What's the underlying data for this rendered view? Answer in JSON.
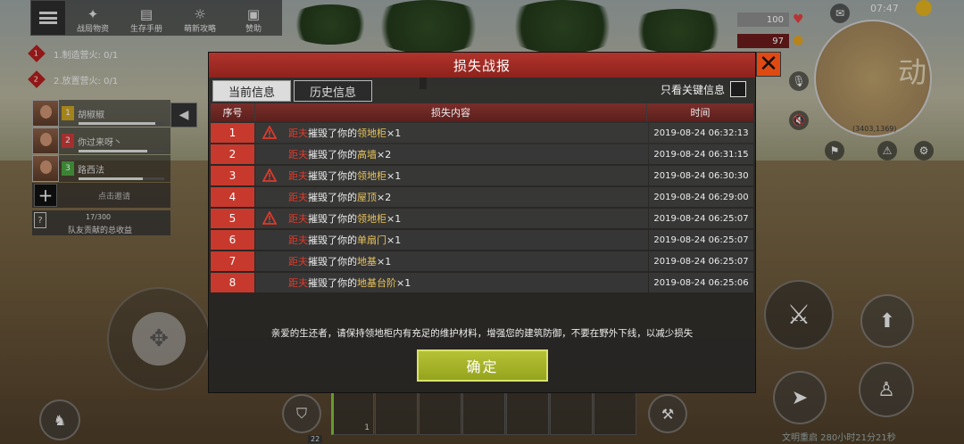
{
  "top_menu": {
    "items": [
      {
        "label": "战局物资",
        "icon": "treasure-icon"
      },
      {
        "label": "生存手册",
        "icon": "book-icon"
      },
      {
        "label": "萌新攻略",
        "icon": "guide-icon"
      },
      {
        "label": "赞助",
        "icon": "sponsor-icon"
      }
    ]
  },
  "quests": [
    {
      "text": "1.制造营火: 0/1",
      "num": "1"
    },
    {
      "text": "2.放置营火: 0/1",
      "num": "2"
    }
  ],
  "team": {
    "members": [
      {
        "num": "1",
        "name": "胡椒椒",
        "hp": 0.9,
        "color": "#c8a020"
      },
      {
        "num": "2",
        "name": "你过来呀丶",
        "hp": 0.8,
        "color": "#c83a3a"
      },
      {
        "num": "3",
        "name": "路西法",
        "hp": 0.75,
        "color": "#4aa040"
      }
    ],
    "invite_label": "点击邀请",
    "contribution_count": "17/300",
    "contribution_label": "队友贡献的总收益"
  },
  "status": {
    "health": "100",
    "food": "97",
    "clock": "07:47",
    "coords": "(3403,1369)",
    "map_label": "动",
    "civ_text": "文明重启 280小时21分21秒"
  },
  "hotbar": {
    "first_count": "1",
    "level": "22"
  },
  "dialog": {
    "title": "损失战报",
    "tabs": {
      "current": "当前信息",
      "history": "历史信息"
    },
    "filter_label": "只看关键信息",
    "columns": {
      "index": "序号",
      "content": "损失内容",
      "time": "时间"
    },
    "rows": [
      {
        "index": "1",
        "warn": true,
        "who": "距夫",
        "verb": "摧毁了你的",
        "object": "领地柜",
        "count": "×1",
        "time": "2019-08-24 06:32:13"
      },
      {
        "index": "2",
        "warn": false,
        "who": "距夫",
        "verb": "摧毁了你的",
        "object": "高墙",
        "count": "×2",
        "time": "2019-08-24 06:31:15"
      },
      {
        "index": "3",
        "warn": true,
        "who": "距夫",
        "verb": "摧毁了你的",
        "object": "领地柜",
        "count": "×1",
        "time": "2019-08-24 06:30:30"
      },
      {
        "index": "4",
        "warn": false,
        "who": "距夫",
        "verb": "摧毁了你的",
        "object": "屋顶",
        "count": "×2",
        "time": "2019-08-24 06:29:00"
      },
      {
        "index": "5",
        "warn": true,
        "who": "距夫",
        "verb": "摧毁了你的",
        "object": "领地柜",
        "count": "×1",
        "time": "2019-08-24 06:25:07"
      },
      {
        "index": "6",
        "warn": false,
        "who": "距夫",
        "verb": "摧毁了你的",
        "object": "单扇门",
        "count": "×1",
        "time": "2019-08-24 06:25:07"
      },
      {
        "index": "7",
        "warn": false,
        "who": "距夫",
        "verb": "摧毁了你的",
        "object": "地基",
        "count": "×1",
        "time": "2019-08-24 06:25:07"
      },
      {
        "index": "8",
        "warn": false,
        "who": "距夫",
        "verb": "摧毁了你的",
        "object": "地基台阶",
        "count": "×1",
        "time": "2019-08-24 06:25:06"
      }
    ],
    "notice": "亲爱的生还者，请保持领地柜内有充足的维护材料，增强您的建筑防御，不要在野外下线，以减少损失",
    "confirm_label": "确定",
    "close_icon": "close-icon"
  },
  "colors": {
    "title_red": "#9e2a22",
    "index_red": "#c8392d",
    "attacker_red": "#e03a2a",
    "object_gold": "#e9c45a",
    "confirm_green": "#a5b22a",
    "close_orange": "#e04a12"
  }
}
